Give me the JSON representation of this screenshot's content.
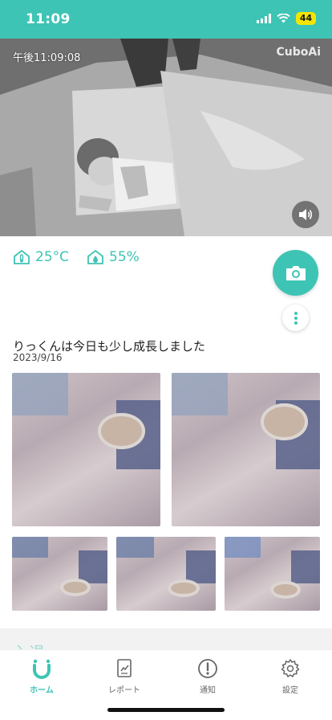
{
  "status_bar": {
    "time": "11:09",
    "battery": "44"
  },
  "camera": {
    "timestamp": "午後11:09:08",
    "brand": "CuboAi"
  },
  "environment": {
    "temperature": "25°C",
    "humidity": "55%"
  },
  "growth": {
    "title": "りっくんは今日も少し成長しました",
    "date": "2023/9/16"
  },
  "partial_heading": "入退",
  "tabs": [
    {
      "label": "ホーム",
      "icon": "home-icon",
      "active": true
    },
    {
      "label": "レポート",
      "icon": "report-icon",
      "active": false
    },
    {
      "label": "通知",
      "icon": "notification-icon",
      "active": false
    },
    {
      "label": "設定",
      "icon": "settings-icon",
      "active": false
    }
  ],
  "colors": {
    "accent": "#3ec4b4",
    "battery": "#f4e500"
  }
}
